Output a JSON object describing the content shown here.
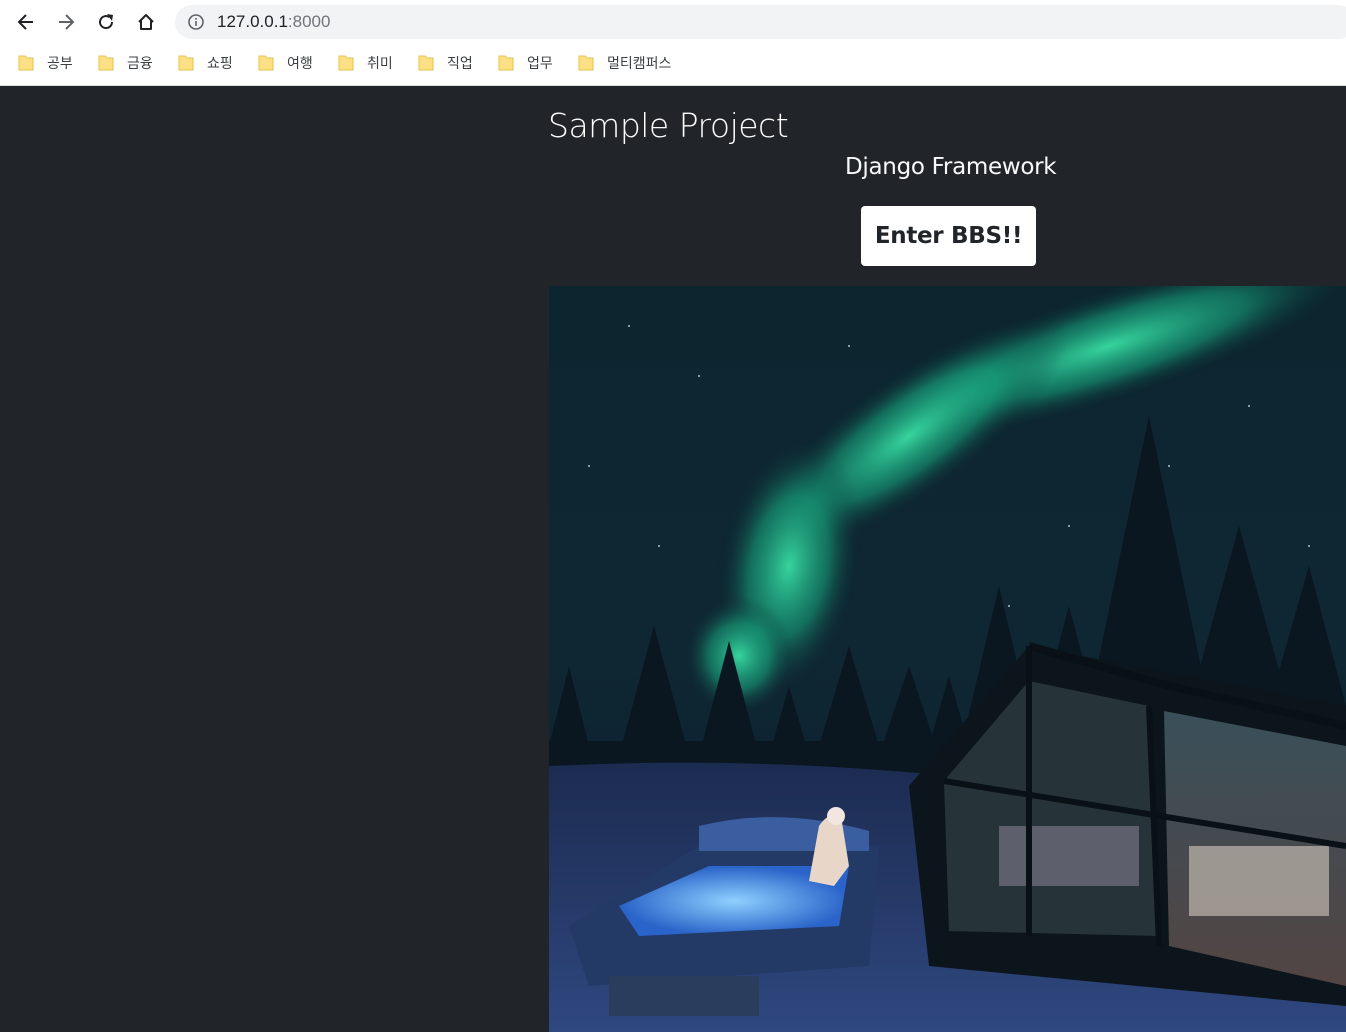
{
  "browser": {
    "url_host": "127.0.0.1",
    "url_port": ":8000",
    "icons": {
      "back": "arrow-left-icon",
      "forward": "arrow-right-icon",
      "reload": "reload-icon",
      "home": "home-icon",
      "site_info": "info-icon"
    }
  },
  "bookmarks": [
    {
      "label": "공부",
      "icon": "folder-icon"
    },
    {
      "label": "금융",
      "icon": "folder-icon"
    },
    {
      "label": "쇼핑",
      "icon": "folder-icon"
    },
    {
      "label": "여행",
      "icon": "folder-icon"
    },
    {
      "label": "취미",
      "icon": "folder-icon"
    },
    {
      "label": "직업",
      "icon": "folder-icon"
    },
    {
      "label": "업무",
      "icon": "folder-icon"
    },
    {
      "label": "멀티캠퍼스",
      "icon": "folder-icon"
    }
  ],
  "page": {
    "title": "Sample Project",
    "subtitle": "Django Framework",
    "enter_button": "Enter BBS!!",
    "hero_image": "aurora-glass-igloo-hot-tub-photo",
    "colors": {
      "background": "#212529",
      "button_bg": "#ffffff",
      "button_text": "#212529",
      "title_text": "#ffffff"
    }
  }
}
